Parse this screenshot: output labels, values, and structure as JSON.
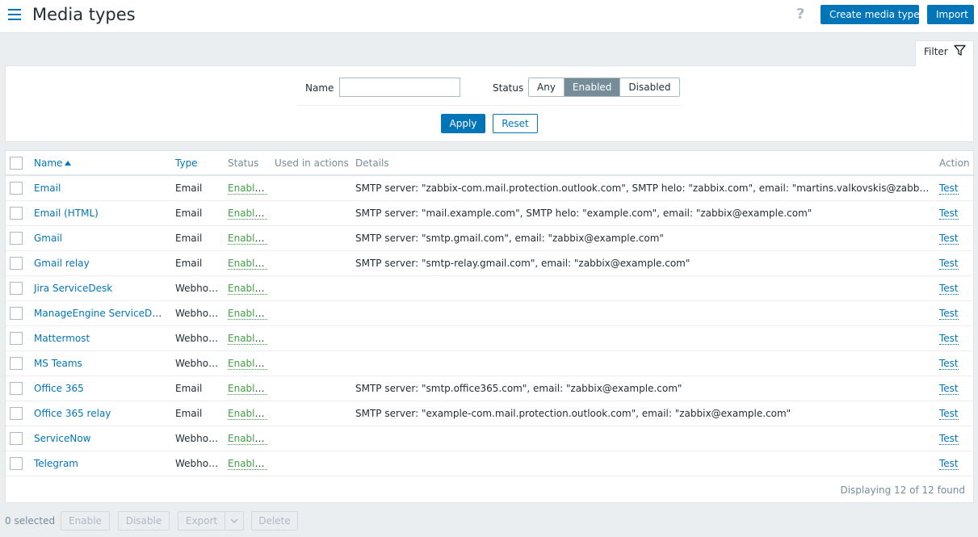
{
  "header": {
    "title": "Media types",
    "help_icon": "?",
    "create_label": "Create media type",
    "import_label": "Import"
  },
  "filter": {
    "tab_label": "Filter",
    "name_label": "Name",
    "name_value": "",
    "status_label": "Status",
    "status_options": [
      "Any",
      "Enabled",
      "Disabled"
    ],
    "status_selected": "Enabled",
    "apply_label": "Apply",
    "reset_label": "Reset"
  },
  "table": {
    "columns": [
      "Name",
      "Type",
      "Status",
      "Used in actions",
      "Details",
      "Action"
    ],
    "rows": [
      {
        "name": "Email",
        "type": "Email",
        "status": "Enabled",
        "used": "",
        "details": "SMTP server: \"zabbix-com.mail.protection.outlook.com\", SMTP helo: \"zabbix.com\", email: \"martins.valkovskis@zabbix.com\"",
        "action": "Test"
      },
      {
        "name": "Email (HTML)",
        "type": "Email",
        "status": "Enabled",
        "used": "",
        "details": "SMTP server: \"mail.example.com\", SMTP helo: \"example.com\", email: \"zabbix@example.com\"",
        "action": "Test"
      },
      {
        "name": "Gmail",
        "type": "Email",
        "status": "Enabled",
        "used": "",
        "details": "SMTP server: \"smtp.gmail.com\", email: \"zabbix@example.com\"",
        "action": "Test"
      },
      {
        "name": "Gmail relay",
        "type": "Email",
        "status": "Enabled",
        "used": "",
        "details": "SMTP server: \"smtp-relay.gmail.com\", email: \"zabbix@example.com\"",
        "action": "Test"
      },
      {
        "name": "Jira ServiceDesk",
        "type": "Webhook",
        "status": "Enabled",
        "used": "",
        "details": "",
        "action": "Test"
      },
      {
        "name": "ManageEngine ServiceDesk",
        "type": "Webhook",
        "status": "Enabled",
        "used": "",
        "details": "",
        "action": "Test"
      },
      {
        "name": "Mattermost",
        "type": "Webhook",
        "status": "Enabled",
        "used": "",
        "details": "",
        "action": "Test"
      },
      {
        "name": "MS Teams",
        "type": "Webhook",
        "status": "Enabled",
        "used": "",
        "details": "",
        "action": "Test"
      },
      {
        "name": "Office 365",
        "type": "Email",
        "status": "Enabled",
        "used": "",
        "details": "SMTP server: \"smtp.office365.com\", email: \"zabbix@example.com\"",
        "action": "Test"
      },
      {
        "name": "Office 365 relay",
        "type": "Email",
        "status": "Enabled",
        "used": "",
        "details": "SMTP server: \"example-com.mail.protection.outlook.com\", email: \"zabbix@example.com\"",
        "action": "Test"
      },
      {
        "name": "ServiceNow",
        "type": "Webhook",
        "status": "Enabled",
        "used": "",
        "details": "",
        "action": "Test"
      },
      {
        "name": "Telegram",
        "type": "Webhook",
        "status": "Enabled",
        "used": "",
        "details": "",
        "action": "Test"
      }
    ],
    "footer": "Displaying 12 of 12 found"
  },
  "bottom": {
    "selected": "0 selected",
    "enable_label": "Enable",
    "disable_label": "Disable",
    "export_label": "Export",
    "delete_label": "Delete"
  },
  "colors": {
    "accent": "#0275b8",
    "enabled": "#429e47",
    "selected_segment": "#768d99"
  }
}
